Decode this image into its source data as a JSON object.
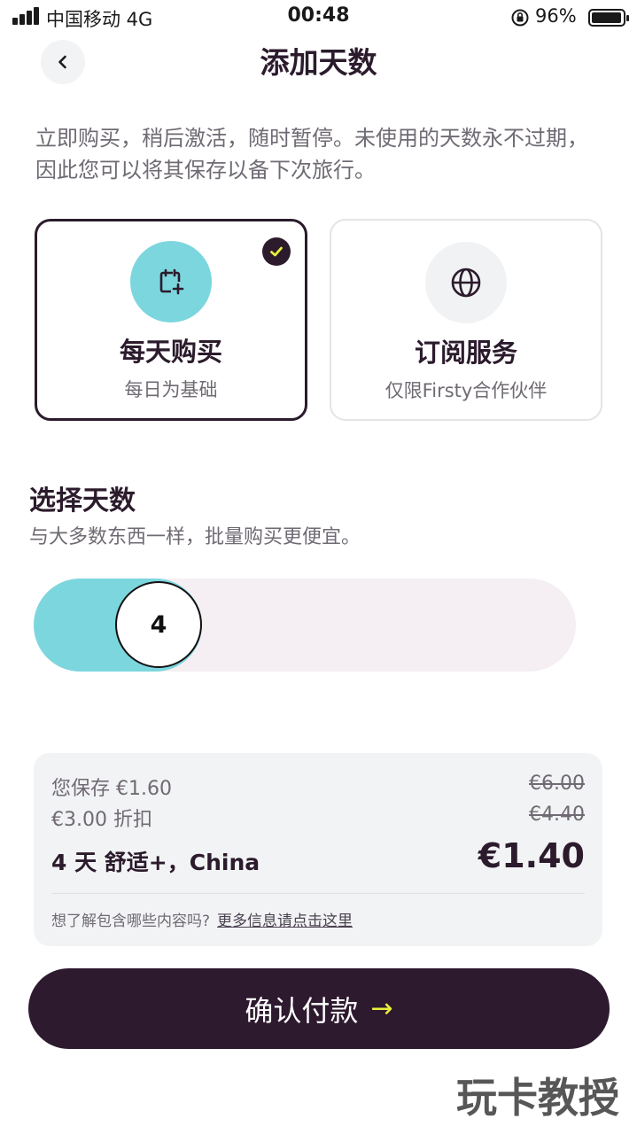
{
  "status_bar": {
    "carrier": "中国移动 4G",
    "time": "00:48",
    "battery": "96%"
  },
  "header": {
    "title": "添加天数"
  },
  "intro": "立即购买，稍后激活，随时暂停。未使用的天数永不过期，因此您可以将其保存以备下次旅行。",
  "plans": [
    {
      "title": "每天购买",
      "subtitle": "每日为基础",
      "icon": "calendar-plus-icon",
      "selected": true
    },
    {
      "title": "订阅服务",
      "subtitle": "仅限Firsty合作伙伴",
      "icon": "globe-icon",
      "selected": false
    }
  ],
  "days": {
    "title": "选择天数",
    "subtitle": "与大多数东西一样，批量购买更便宜。",
    "value": "4",
    "fill_fraction": 0.31
  },
  "summary": {
    "savings_label": "您保存 €1.60",
    "original_price": "€6.00",
    "discount_label": "€3.00 折扣",
    "discounted_price": "€4.40",
    "plan_label": "4 天 舒适+，China",
    "total": "€1.40",
    "info_question": "想了解包含哪些内容吗?",
    "info_link": "更多信息请点击这里"
  },
  "confirm": {
    "label": "确认付款",
    "arrow": "→"
  },
  "watermark": "玩卡教授",
  "colors": {
    "dark": "#2b1b2c",
    "accent": "#7cd6de",
    "highlight": "#e9f23a"
  }
}
